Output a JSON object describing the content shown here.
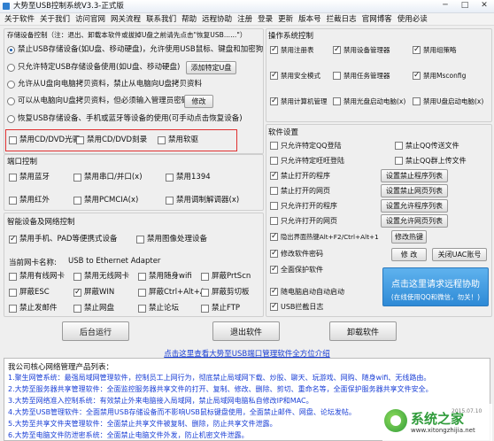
{
  "window": {
    "title": "大势至USB控制系统V3.3-正式版",
    "controls": {
      "minimize": "─",
      "maximize": "□",
      "close": "✕"
    }
  },
  "menu": [
    "关于软件",
    "关于我们",
    "访问官网",
    "网关流程",
    "联系我们",
    "帮助",
    "远程协助",
    "注册",
    "登录",
    "更新",
    "版本号",
    "拦截日志",
    "官网博客",
    "使用必读"
  ],
  "storage": {
    "title": "存储设备控制（注：退出、卸载本软件或拔掉U盘之前请先点击\"恢复USB......\"）",
    "options": [
      {
        "label": "禁止USB存储设备(如U盘、移动硬盘)，允许使用USB鼠标、键盘和加密狗",
        "checked": true
      },
      {
        "label": "只允许特定USB存储设备使用(如U盘、移动硬盘)",
        "checked": false
      },
      {
        "label": "允许从U盘向电脑拷贝资料，禁止从电脑向U盘拷贝资料",
        "checked": false
      },
      {
        "label": "可以从电脑向U盘拷贝资料，但必须输入管理员密码",
        "checked": false
      },
      {
        "label": "恢复USB存储设备、手机或蓝牙等设备的使用(可手动点击恢复设备)",
        "checked": false
      }
    ],
    "add_button": "添加特定U盘",
    "modify_button": "修改",
    "drives": [
      {
        "label": "禁用CD/DVD光驱",
        "checked": false
      },
      {
        "label": "禁用CD/DVD刻录",
        "checked": false
      },
      {
        "label": "禁用软驱",
        "checked": false
      }
    ]
  },
  "ports": {
    "title": "端口控制",
    "items": [
      {
        "label": "禁用蓝牙",
        "checked": false
      },
      {
        "label": "禁用串口/并口(x)",
        "checked": false
      },
      {
        "label": "禁用1394",
        "checked": false
      },
      {
        "label": "禁用红外",
        "checked": false
      },
      {
        "label": "禁用PCMCIA(x)",
        "checked": false
      },
      {
        "label": "禁用调制解调器(x)",
        "checked": false
      }
    ]
  },
  "smart": {
    "title": "智能设备及网络控制",
    "items": [
      {
        "label": "禁用手机、PAD等便携式设备",
        "checked": true
      },
      {
        "label": "禁用图像处理设备",
        "checked": false
      }
    ],
    "nic_label": "当前网卡名称:",
    "nic_value": "USB to Ethernet Adapter",
    "grid": [
      {
        "label": "禁用有线网卡",
        "checked": false
      },
      {
        "label": "禁用无线网卡",
        "checked": false
      },
      {
        "label": "禁用随身wifi",
        "checked": false
      },
      {
        "label": "屏蔽PrtScn",
        "checked": false
      },
      {
        "label": "屏蔽ESC",
        "checked": false
      },
      {
        "label": "屏蔽WIN",
        "checked": true
      },
      {
        "label": "屏蔽Ctrl+Alt+A",
        "checked": false
      },
      {
        "label": "屏蔽剪切板",
        "checked": false
      },
      {
        "label": "禁止发邮件",
        "checked": false
      },
      {
        "label": "禁止网盘",
        "checked": false
      },
      {
        "label": "禁止论坛",
        "checked": false
      },
      {
        "label": "禁止FTP",
        "checked": false
      }
    ]
  },
  "os": {
    "title": "操作系统控制",
    "items": [
      {
        "label": "禁用注册表",
        "checked": true
      },
      {
        "label": "禁用设备管理器",
        "checked": true
      },
      {
        "label": "禁用组策略",
        "checked": true
      },
      {
        "label": "禁用安全模式",
        "checked": true
      },
      {
        "label": "禁用任务管理器",
        "checked": false
      },
      {
        "label": "禁用Msconfig",
        "checked": true
      },
      {
        "label": "禁用计算机管理",
        "checked": true
      },
      {
        "label": "禁用光盘启动电脑(x)",
        "checked": false
      },
      {
        "label": "禁用U盘启动电脑(x)",
        "checked": false
      }
    ]
  },
  "software": {
    "title": "软件设置",
    "checks": [
      {
        "label": "只允许特定QQ登陆",
        "checked": false
      },
      {
        "label": "只允许特定旺旺登陆",
        "checked": false
      },
      {
        "label": "禁止打开的程序",
        "checked": true
      },
      {
        "label": "禁止打开的网页",
        "checked": false
      },
      {
        "label": "只允许打开的程序",
        "checked": false
      },
      {
        "label": "只允许打开的网页",
        "checked": false
      },
      {
        "label": "隐出界面热键Alt+F2/Ctrl+Alt+1",
        "checked": true
      },
      {
        "label": "修改软件密码",
        "checked": true
      },
      {
        "label": "全面保护软件",
        "checked": true
      },
      {
        "label": "随电脑启动自动启动",
        "checked": true
      },
      {
        "label": "USB拦截日志",
        "checked": true
      }
    ],
    "qq": [
      {
        "label": "禁止QQ传送文件",
        "checked": false
      },
      {
        "label": "禁止QQ群上传文件",
        "checked": false
      }
    ],
    "buttons": {
      "block_programs": "设置禁止程序列表",
      "block_sites": "设置禁止网页列表",
      "allow_programs": "设置允许程序列表",
      "allow_sites": "设置允许网页列表",
      "hotkey": "修改热键",
      "password": "修 改",
      "uac": "关闭UAC账号"
    },
    "remote": {
      "line1": "点击这里请求远程协助",
      "line2": "(在线使用QQ和微信，勿关！)"
    }
  },
  "actions": {
    "background": "后台运行",
    "exit": "退出软件",
    "uninstall": "卸载软件"
  },
  "link": "点击这里查看大势至USB端口管理软件全方位介绍",
  "products": {
    "title": "我公司核心网络管理产品列表：",
    "lines": [
      "1.聚生网管系统：最强局域网管理软件，控制员工上网行为，彻底禁止局域网下载、炒股、聊天、玩游戏、网购、随身wifi、无线路由。",
      "2.大势至服务器共享管理软件：全面监控服务器共享文件的打开、复制、修改、删除、剪切、重命名等，全面保护服务器共享文件安全。",
      "3.大势至网络准入控制系统：有效禁止外来电脑接入局域网，禁止局域网电脑私自修改IP和MAC。",
      "4.大势至USB管理软件：全面禁用USB存储设备而不影响USB鼠标键盘使用，全面禁止邮件、网盘、论坛发帖。",
      "5.大势至共享文件夹管理软件：全面禁止共享文件被复制、删除，防止共享文件泄露。",
      "6.大势至电脑文件防泄密系统：全面禁止电脑文件外发，防止机密文件泄露。"
    ]
  },
  "watermark": {
    "brand": "系统之家",
    "url": "www.xitongzhijia.net",
    "date": "2015.07.10"
  },
  "colors": {
    "remote_button": "#2e8ad6",
    "link": "#1a3fd6",
    "highlight_border": "#e03030",
    "watermark": "#2f9b3a"
  }
}
